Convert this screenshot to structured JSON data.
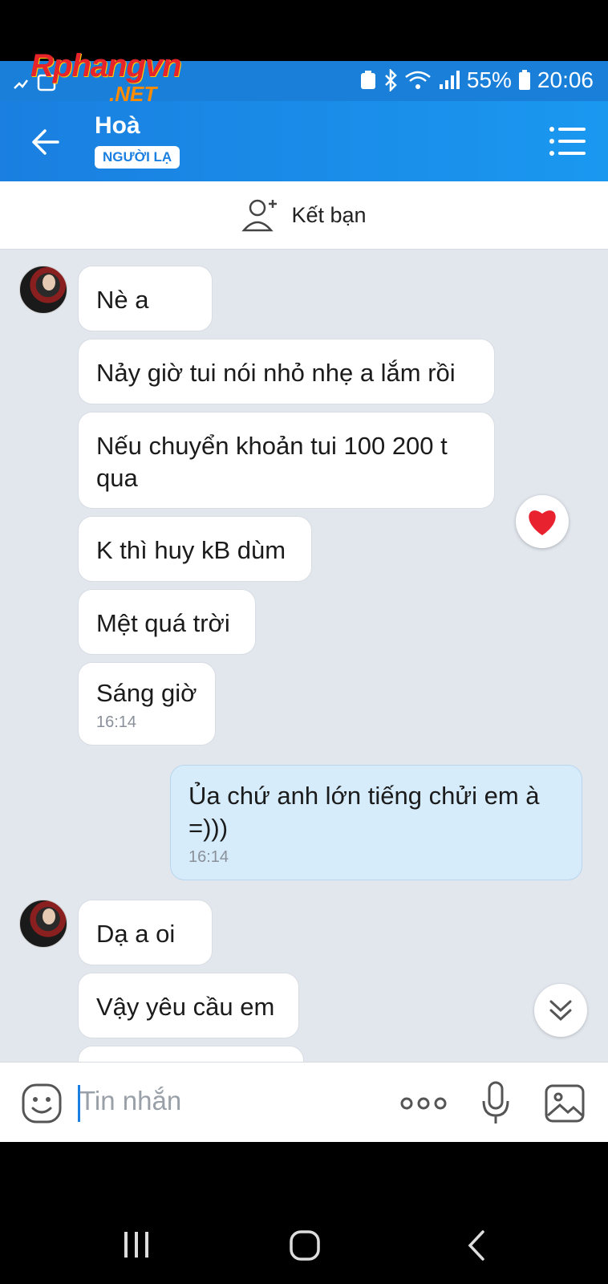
{
  "watermark": {
    "line1": "Rphangvn",
    "line2": ".NET"
  },
  "status_bar": {
    "battery": "55%",
    "time": "20:06"
  },
  "header": {
    "contact_name": "Hoà",
    "badge": "NGƯỜI LẠ"
  },
  "friend_bar": {
    "label": "Kết bạn"
  },
  "messages": [
    {
      "dir": "in",
      "text": "Nè a"
    },
    {
      "dir": "in",
      "text": "Nảy giờ tui nói nhỏ nhẹ a lắm rồi"
    },
    {
      "dir": "in",
      "text": "Nếu chuyển khoản tui 100 200 t qua"
    },
    {
      "dir": "in",
      "text": "K thì huy kB dùm"
    },
    {
      "dir": "in",
      "text": "Mệt quá trời"
    },
    {
      "dir": "in",
      "text": "Sáng giờ",
      "time": "16:14"
    },
    {
      "dir": "out",
      "text": "Ủa chứ anh lớn tiếng chửi em à =)))",
      "time": "16:14"
    },
    {
      "dir": "in",
      "text": "Dạ a oi"
    },
    {
      "dir": "in",
      "text": "Vậy yêu cầu em"
    }
  ],
  "reaction": {
    "icon": "heart-icon",
    "color": "#e8232f"
  },
  "composer": {
    "placeholder": "Tin nhắn"
  },
  "colors": {
    "header": "#1a7fe0",
    "chat_bg": "#e2e7ee",
    "outgoing_bubble": "#d6ecfb"
  }
}
